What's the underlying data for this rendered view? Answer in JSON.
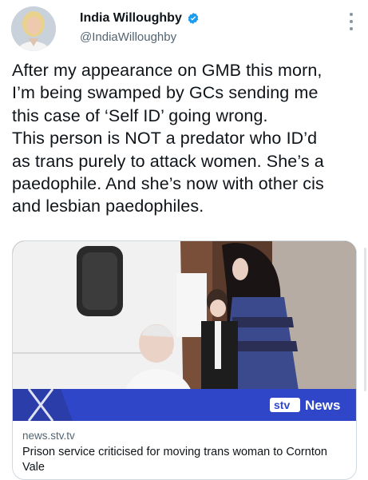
{
  "author": {
    "display_name": "India Willoughby",
    "handle": "@IndiaWilloughby",
    "verified": true
  },
  "icons": {
    "verified": "verified-badge-icon",
    "more": "more-options-icon"
  },
  "tweet": {
    "text": "After my appearance on GMB this morn,\nI’m being swamped by GCs sending me\nthis case of ‘Self ID’ going wrong.\nThis person is NOT a predator who ID’d\nas trans purely to attack women. She’s a\npaedophile. And she’s now with other cis\nand lesbian paedophiles."
  },
  "link_card": {
    "image_overlay_brand": "stv",
    "image_overlay_label": "News",
    "domain": "news.stv.tv",
    "title": "Prison service criticised for moving trans woman to Cornton Vale"
  },
  "colors": {
    "verified_blue": "#1d9bf0",
    "muted_text": "#536471",
    "card_border": "#cfd9de",
    "stv_banner_blue": "#2f46c9"
  }
}
